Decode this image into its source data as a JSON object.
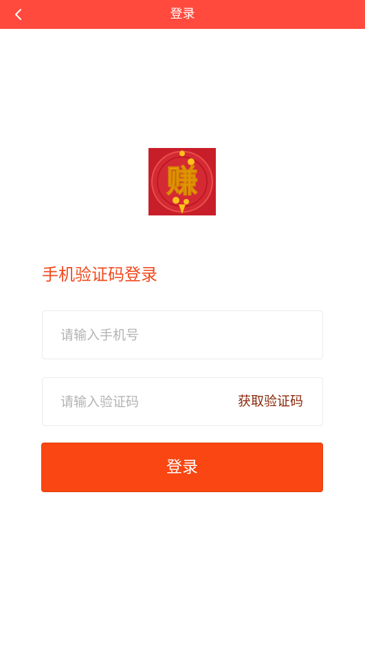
{
  "header": {
    "title": "登录",
    "back_icon": "chevron-left-icon",
    "background": "#ff4a3d"
  },
  "logo": {
    "glyph": "赚",
    "background": "#c81e2a",
    "glyph_color": "#ffd21a"
  },
  "login": {
    "section_title": "手机验证码登录",
    "phone_placeholder": "请输入手机号",
    "phone_value": "",
    "code_placeholder": "请输入验证码",
    "code_value": "",
    "get_code_label": "获取验证码",
    "submit_label": "登录",
    "accent": "#fa4612"
  }
}
